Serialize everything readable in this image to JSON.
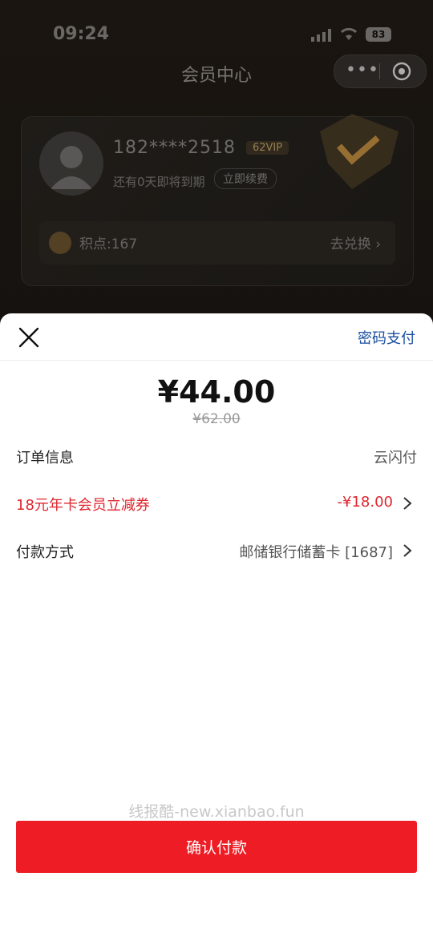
{
  "status_bar": {
    "time": "09:24",
    "battery": "83"
  },
  "nav": {
    "title": "会员中心",
    "more_icon": "more-icon",
    "close_icon": "close-circle-icon"
  },
  "member_card": {
    "phone": "182****2518",
    "vip_tag": "62VIP",
    "expire_text": "还有0天即将到期",
    "renew_label": "立即续费",
    "points_label": "积点:167",
    "redeem_label": "去兑换"
  },
  "payment_sheet": {
    "password_pay": "密码支付",
    "amount": "¥44.00",
    "original_amount": "¥62.00",
    "rows": [
      {
        "label": "订单信息",
        "value": "云闪付"
      },
      {
        "label": "18元年卡会员立减券",
        "value": "-¥18.00"
      },
      {
        "label": "付款方式",
        "value": "邮储银行储蓄卡 [1687]"
      }
    ],
    "watermark": "线报酷-new.xianbao.fun",
    "confirm_label": "确认付款"
  },
  "colors": {
    "accent_red": "#ee1c24",
    "link_blue": "#1a4ea0",
    "coupon_red": "#e0242e"
  }
}
